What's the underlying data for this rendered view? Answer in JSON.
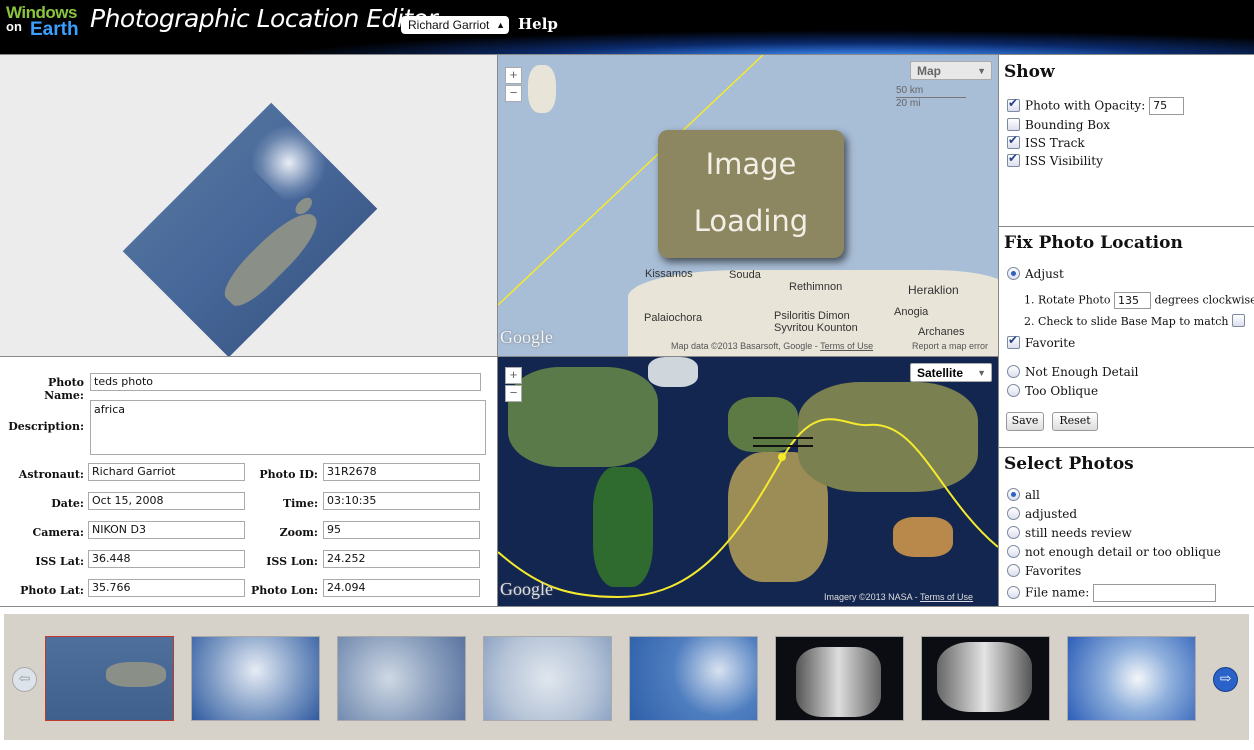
{
  "header": {
    "logo_line1": "Windows",
    "logo_line2": "on",
    "logo_line3": "Earth",
    "title": "Photographic Location Editor",
    "user_selected": "Richard Garriot",
    "help": "Help"
  },
  "top_map": {
    "zoom_in": "+",
    "zoom_out": "−",
    "map_type": "Map",
    "scale_km": "50 km",
    "scale_mi": "20 mi",
    "loading_line1": "Image",
    "loading_line2": "Loading",
    "cities": [
      "Kissamos",
      "Souda",
      "Rethimnon",
      "Heraklion",
      "Palaiochora",
      "Psiloritis Dimon",
      "Syvritou Kounton",
      "Anogia",
      "Archanes"
    ],
    "google": "Google",
    "attribution": "Map data ©2013 Basarsoft, Google -",
    "terms": "Terms of Use",
    "report": "Report a map error"
  },
  "bottom_map": {
    "zoom_in": "+",
    "zoom_out": "−",
    "map_type": "Satellite",
    "google": "Google",
    "attribution": "Imagery ©2013 NASA -",
    "terms": "Terms of Use"
  },
  "form": {
    "photo_name_label": "Photo Name:",
    "photo_name": "teds photo",
    "description_label": "Description:",
    "description": "africa",
    "astronaut_label": "Astronaut:",
    "astronaut": "Richard Garriot",
    "photo_id_label": "Photo ID:",
    "photo_id": "31R2678",
    "date_label": "Date:",
    "date": "Oct 15, 2008",
    "time_label": "Time:",
    "time": "03:10:35",
    "camera_label": "Camera:",
    "camera": "NIKON D3",
    "zoom_label": "Zoom:",
    "zoom": "95",
    "iss_lat_label": "ISS Lat:",
    "iss_lat": "36.448",
    "iss_lon_label": "ISS Lon:",
    "iss_lon": "24.252",
    "photo_lat_label": "Photo Lat:",
    "photo_lat": "35.766",
    "photo_lon_label": "Photo Lon:",
    "photo_lon": "24.094"
  },
  "show": {
    "title": "Show",
    "photo_opacity_label": "Photo with Opacity:",
    "photo_opacity": "75",
    "bounding_box": "Bounding Box",
    "iss_track": "ISS Track",
    "iss_visibility": "ISS Visibility"
  },
  "fix": {
    "title": "Fix Photo Location",
    "adjust": "Adjust",
    "step1_num": "1.",
    "rotate_label": "Rotate Photo",
    "rotate_value": "135",
    "rotate_suffix": "degrees clockwise",
    "step2_num": "2.",
    "slide_label": "Check to slide Base Map to match",
    "favorite": "Favorite",
    "not_enough": "Not Enough Detail",
    "too_oblique": "Too Oblique",
    "save": "Save",
    "reset": "Reset"
  },
  "select": {
    "title": "Select Photos",
    "all": "all",
    "adjusted": "adjusted",
    "still_needs": "still needs review",
    "not_enough_or_oblique": "not enough detail or too oblique",
    "favorites": "Favorites",
    "file_name": "File name:"
  },
  "filmstrip": {
    "thumbnails": [
      "crete-island-photo",
      "clouds-photo",
      "clouds-photo",
      "clouds-photo",
      "ocean-clouds-photo",
      "spacecraft-photo",
      "spacecraft-photo",
      "cloud-photo"
    ]
  },
  "colors": {
    "accent_blue": "#2a62c9",
    "loading_bg": "#8c8661",
    "track_yellow": "#f5ea2c"
  }
}
